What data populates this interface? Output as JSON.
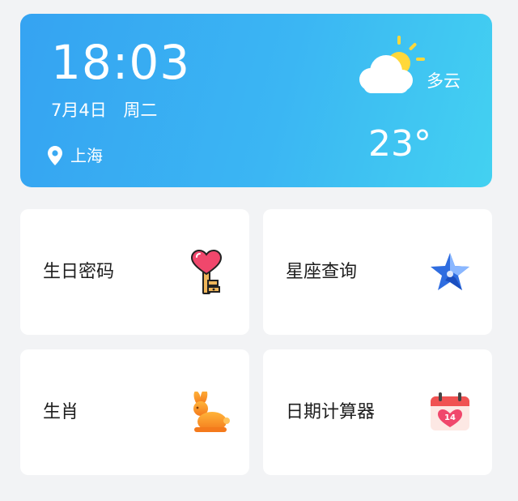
{
  "weather_card": {
    "time": "18:03",
    "date": "7月4日 周二",
    "location": "上海",
    "condition": "多云",
    "temperature": "23°",
    "condition_icon": "partly-cloudy-icon",
    "location_icon": "location-pin-icon"
  },
  "tiles": [
    {
      "label": "生日密码",
      "icon": "heart-key-icon"
    },
    {
      "label": "星座查询",
      "icon": "star-icon"
    },
    {
      "label": "生肖",
      "icon": "rabbit-icon"
    },
    {
      "label": "日期计算器",
      "icon": "calendar-icon",
      "icon_text": "14"
    }
  ],
  "colors": {
    "card_gradient_start": "#35a3f2",
    "card_gradient_end": "#43d1f1",
    "background": "#f2f3f5",
    "tile_background": "#ffffff",
    "label_text": "#1e1e1e"
  }
}
